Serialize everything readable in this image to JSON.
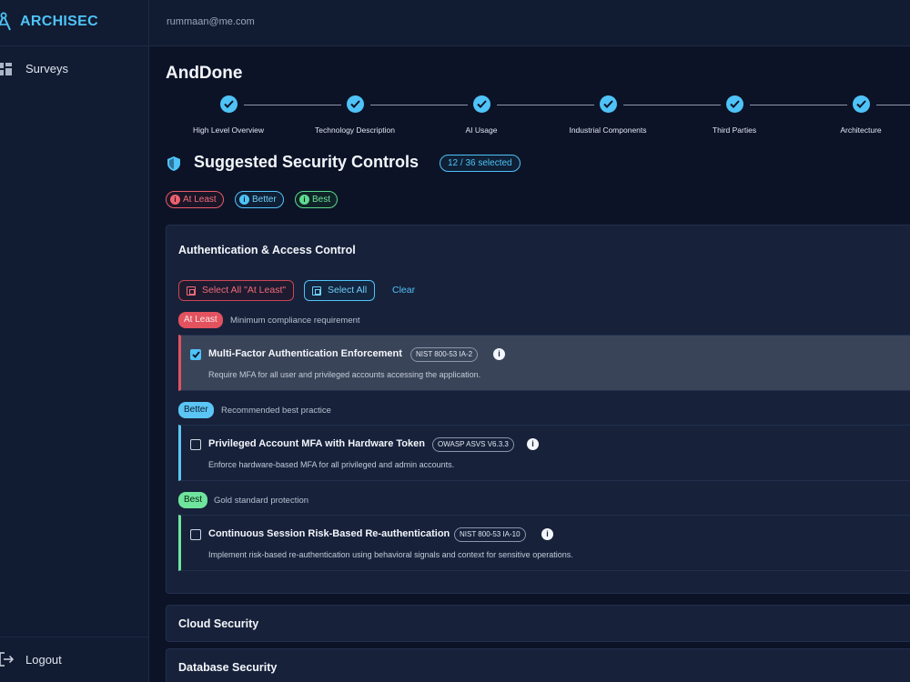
{
  "app": {
    "name": "ARCHISEC"
  },
  "sidebar": {
    "items": [
      {
        "label": "Surveys",
        "icon": "grid-icon"
      }
    ],
    "logout_label": "Logout"
  },
  "topbar": {
    "email": "rummaan@me.com"
  },
  "page": {
    "title": "AndDone"
  },
  "stepper": {
    "steps": [
      {
        "label": "High Level Overview",
        "status": "complete"
      },
      {
        "label": "Technology Description",
        "status": "complete"
      },
      {
        "label": "AI Usage",
        "status": "complete"
      },
      {
        "label": "Industrial Components",
        "status": "complete"
      },
      {
        "label": "Third Parties",
        "status": "complete"
      },
      {
        "label": "Architecture",
        "status": "complete"
      }
    ]
  },
  "controls_section": {
    "title": "Suggested Security Controls",
    "selected_count": "12 / 36 selected",
    "legend": {
      "at_least": "At Least",
      "better": "Better",
      "best": "Best"
    }
  },
  "panel": {
    "title": "Authentication & Access Control",
    "select_at_least_label": "Select All \"At Least\"",
    "select_all_label": "Select All",
    "clear_label": "Clear",
    "tiers": [
      {
        "tag": "At Least",
        "description": "Minimum compliance requirement",
        "control": {
          "title": "Multi-Factor Authentication Enforcement",
          "ref": "NIST 800-53 IA-2",
          "description": "Require MFA for all user and privileged accounts accessing the application.",
          "checked": true
        }
      },
      {
        "tag": "Better",
        "description": "Recommended best practice",
        "control": {
          "title": "Privileged Account MFA with Hardware Token",
          "ref": "OWASP ASVS V6.3.3",
          "description": "Enforce hardware-based MFA for all privileged and admin accounts.",
          "checked": false
        }
      },
      {
        "tag": "Best",
        "description": "Gold standard protection",
        "control": {
          "title": "Continuous Session Risk-Based Re-authentication",
          "ref": "NIST 800-53 IA-10",
          "description": "Implement risk-based re-authentication using behavioral signals and context for sensitive operations.",
          "checked": false
        }
      }
    ]
  },
  "collapsed_sections": [
    {
      "title": "Cloud Security"
    },
    {
      "title": "Database Security"
    }
  ],
  "colors": {
    "accent": "#4fc3f7",
    "at_least": "#e2525f",
    "better": "#5bc6f5",
    "best": "#6fe49c",
    "background": "#0c1327"
  }
}
